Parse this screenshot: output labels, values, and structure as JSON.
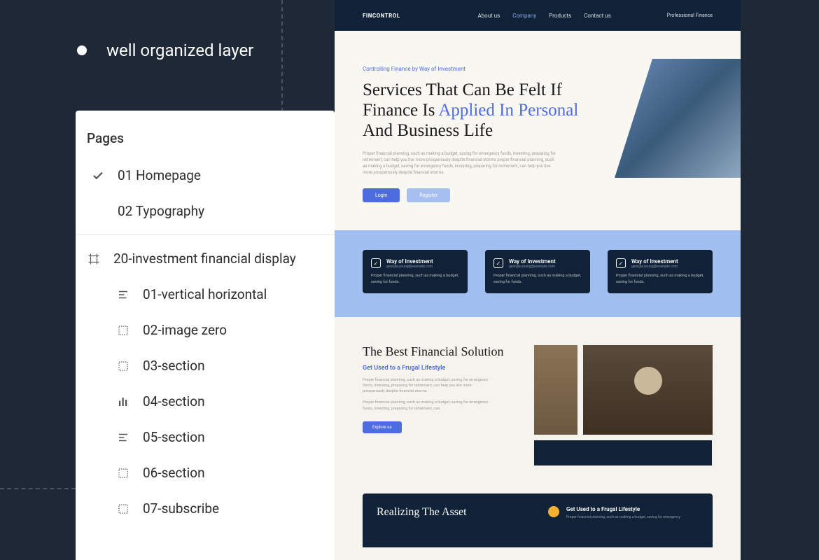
{
  "hero_label": "well organized layer",
  "layers": {
    "title": "Pages",
    "pages": [
      {
        "label": "01 Homepage",
        "icon": "check"
      },
      {
        "label": "02 Typography",
        "icon": "none"
      }
    ],
    "frame": {
      "label": "20-investment financial display",
      "icon": "frame"
    },
    "children": [
      {
        "label": "01-vertical horizontal",
        "icon": "lines"
      },
      {
        "label": "02-image zero",
        "icon": "rect-dashed"
      },
      {
        "label": "03-section",
        "icon": "rect-dashed"
      },
      {
        "label": "04-section",
        "icon": "bars"
      },
      {
        "label": "05-section",
        "icon": "lines"
      },
      {
        "label": "06-section",
        "icon": "rect-dashed"
      },
      {
        "label": "07-subscribe",
        "icon": "rect-dashed"
      }
    ]
  },
  "preview": {
    "header": {
      "logo": "FINCONTROL",
      "nav": [
        "About us",
        "Company",
        "Products",
        "Contact us"
      ],
      "active_index": 1,
      "tag": "Professional Finance"
    },
    "hero": {
      "eyebrow": "Controlling Finance by Way of Investment",
      "title_1": "Services That Can Be Felt If Finance Is ",
      "title_accent": "Applied In Personal",
      "title_2": " And Business Life",
      "desc": "Proper financial planning, such as making a budget, saving for emergency funds, investing, preparing for retirement, can help you live more prosperously despite financial storms proper financial planning, such as making a budget, saving for emergency funds, investing, preparing for retirement, can help you live more prosperously despite financial storms.",
      "btn_primary": "Login",
      "btn_secondary": "Register"
    },
    "cards": [
      {
        "title": "Way of Investment",
        "sub": "georgia.young@example.com",
        "body": "Proper financial planning, such as making a budget, saving for funds."
      },
      {
        "title": "Way of Investment",
        "sub": "georgia.young@example.com",
        "body": "Proper financial planning, such as making a budget, saving for funds."
      },
      {
        "title": "Way of Investment",
        "sub": "georgia.young@example.com",
        "body": "Proper financial planning, such as making a budget, saving for funds."
      }
    ],
    "solution": {
      "title": "The Best Financial Solution",
      "sub": "Get Used to a Frugal Lifestyle",
      "desc1": "Proper financial planning, such as making a budget, saving for emergency funds, investing, preparing for retirement, can help you live more prosperously despite financial storms.",
      "desc2": "Proper financial planning, such as making a budget, saving for emergency funds, investing, preparing for retirement, can.",
      "btn": "Explore us"
    },
    "cta": {
      "title": "Realizing The Asset",
      "right_title": "Get Used to a Frugal Lifestyle",
      "right_desc": "Proper financial planning, such as making a budget, saving for emergency"
    }
  }
}
